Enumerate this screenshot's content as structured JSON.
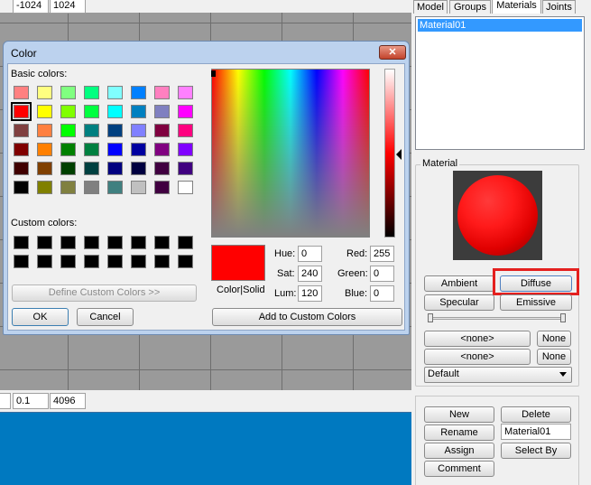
{
  "viewport_top": {
    "min": "-1024",
    "max": "1024"
  },
  "viewport_bottom": {
    "step": "0.1",
    "size": "4096"
  },
  "tabs": [
    "Model",
    "Groups",
    "Materials",
    "Joints"
  ],
  "material_list": [
    "Material01"
  ],
  "material_panel": {
    "title": "Material",
    "ambient": "Ambient",
    "diffuse": "Diffuse",
    "specular": "Specular",
    "emissive": "Emissive",
    "tex1": "<none>",
    "tex1_none": "None",
    "tex2": "<none>",
    "tex2_none": "None",
    "mode": "Default",
    "new": "New",
    "delete": "Delete",
    "rename": "Rename",
    "name_value": "Material01",
    "assign": "Assign",
    "select_by": "Select By",
    "comment": "Comment"
  },
  "dialog": {
    "title": "Color",
    "basic_label": "Basic colors:",
    "custom_label": "Custom colors:",
    "define_custom": "Define Custom Colors >>",
    "ok": "OK",
    "cancel": "Cancel",
    "color_solid": "Color|Solid",
    "add_custom": "Add to Custom Colors",
    "hue_label": "Hue:",
    "hue": "0",
    "sat_label": "Sat:",
    "sat": "240",
    "lum_label": "Lum:",
    "lum": "120",
    "red_label": "Red:",
    "red": "255",
    "green_label": "Green:",
    "green": "0",
    "blue_label": "Blue:",
    "blue": "0",
    "close_symbol": "✕",
    "basic_colors": [
      "#ff8080",
      "#ffff80",
      "#80ff80",
      "#00ff80",
      "#80ffff",
      "#0080ff",
      "#ff80c0",
      "#ff80ff",
      "#ff0000",
      "#ffff00",
      "#80ff00",
      "#00ff40",
      "#00ffff",
      "#0080c0",
      "#8080c0",
      "#ff00ff",
      "#804040",
      "#ff8040",
      "#00ff00",
      "#008080",
      "#004080",
      "#8080ff",
      "#800040",
      "#ff0080",
      "#800000",
      "#ff8000",
      "#008000",
      "#008040",
      "#0000ff",
      "#0000a0",
      "#800080",
      "#8000ff",
      "#400000",
      "#804000",
      "#004000",
      "#004040",
      "#000080",
      "#000040",
      "#400040",
      "#400080",
      "#000000",
      "#808000",
      "#808040",
      "#808080",
      "#408080",
      "#c0c0c0",
      "#400040",
      "#ffffff"
    ],
    "custom_colors": [
      "#000000",
      "#000000",
      "#000000",
      "#000000",
      "#000000",
      "#000000",
      "#000000",
      "#000000",
      "#000000",
      "#000000",
      "#000000",
      "#000000",
      "#000000",
      "#000000",
      "#000000",
      "#000000"
    ],
    "selected_color": "#ff0000"
  }
}
